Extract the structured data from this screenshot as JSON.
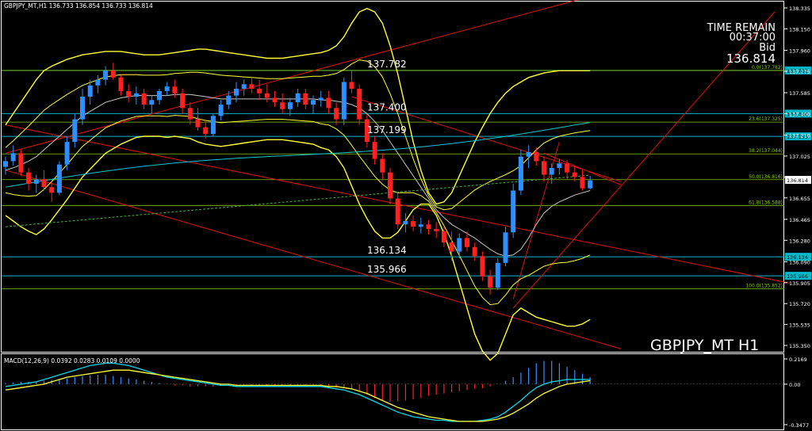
{
  "window": {
    "header": "GBPJPY_MT,H1  136.733 136.854 136.733 136.814",
    "symbol_label": "GBPJPY_MT H1"
  },
  "timer": {
    "title": "TIME REMAIN",
    "value": "00:37:00",
    "bid_label": "Bid",
    "bid_value": "136.814"
  },
  "chart_data": [
    {
      "type": "line",
      "title": "GBPJPY_MT,H1",
      "ylim": [
        135.35,
        138.335
      ],
      "y_ticks": [
        "138.335",
        "138.150",
        "137.960",
        "137.775",
        "137.585",
        "137.400",
        "137.210",
        "137.025",
        "136.840",
        "136.655",
        "136.465",
        "136.280",
        "136.090",
        "135.905",
        "135.720",
        "135.535",
        "135.350"
      ],
      "candles": [
        [
          136.93,
          137.02,
          136.86,
          136.98
        ],
        [
          136.98,
          137.12,
          136.94,
          137.05
        ],
        [
          137.05,
          137.08,
          136.85,
          136.88
        ],
        [
          136.88,
          136.92,
          136.72,
          136.78
        ],
        [
          136.78,
          136.86,
          136.7,
          136.82
        ],
        [
          136.82,
          136.9,
          136.72,
          136.75
        ],
        [
          136.75,
          136.8,
          136.62,
          136.7
        ],
        [
          136.7,
          136.98,
          136.68,
          136.95
        ],
        [
          136.95,
          137.2,
          136.9,
          137.15
        ],
        [
          137.15,
          137.4,
          137.1,
          137.35
        ],
        [
          137.35,
          137.62,
          137.3,
          137.55
        ],
        [
          137.55,
          137.7,
          137.48,
          137.65
        ],
        [
          137.65,
          137.74,
          137.58,
          137.7
        ],
        [
          137.7,
          137.82,
          137.65,
          137.78
        ],
        [
          137.78,
          137.85,
          137.7,
          137.72
        ],
        [
          137.72,
          137.74,
          137.56,
          137.6
        ],
        [
          137.6,
          137.66,
          137.5,
          137.55
        ],
        [
          137.55,
          137.64,
          137.48,
          137.58
        ],
        [
          137.58,
          137.62,
          137.44,
          137.48
        ],
        [
          137.48,
          137.56,
          137.4,
          137.52
        ],
        [
          137.52,
          137.62,
          137.48,
          137.6
        ],
        [
          137.6,
          137.68,
          137.56,
          137.64
        ],
        [
          137.64,
          137.7,
          137.54,
          137.58
        ],
        [
          137.58,
          137.62,
          137.4,
          137.45
        ],
        [
          137.45,
          137.5,
          137.3,
          137.35
        ],
        [
          137.35,
          137.45,
          137.25,
          137.28
        ],
        [
          137.28,
          137.34,
          137.18,
          137.22
        ],
        [
          137.22,
          137.4,
          137.2,
          137.38
        ],
        [
          137.38,
          137.52,
          137.34,
          137.48
        ],
        [
          137.48,
          137.6,
          137.44,
          137.56
        ],
        [
          137.56,
          137.68,
          137.5,
          137.62
        ],
        [
          137.62,
          137.7,
          137.56,
          137.66
        ],
        [
          137.66,
          137.72,
          137.58,
          137.62
        ],
        [
          137.62,
          137.7,
          137.52,
          137.58
        ],
        [
          137.58,
          137.66,
          137.5,
          137.54
        ],
        [
          137.54,
          137.6,
          137.46,
          137.5
        ],
        [
          137.5,
          137.58,
          137.4,
          137.44
        ],
        [
          137.44,
          137.54,
          137.38,
          137.5
        ],
        [
          137.5,
          137.62,
          137.46,
          137.58
        ],
        [
          137.58,
          137.62,
          137.44,
          137.48
        ],
        [
          137.48,
          137.56,
          137.4,
          137.52
        ],
        [
          137.52,
          137.6,
          137.46,
          137.54
        ],
        [
          137.54,
          137.6,
          137.4,
          137.45
        ],
        [
          137.45,
          137.5,
          137.3,
          137.35
        ],
        [
          137.35,
          137.72,
          137.3,
          137.68
        ],
        [
          137.68,
          137.78,
          137.58,
          137.62
        ],
        [
          137.62,
          137.66,
          137.3,
          137.35
        ],
        [
          137.35,
          137.4,
          137.1,
          137.15
        ],
        [
          137.15,
          137.2,
          136.95,
          137.0
        ],
        [
          137.0,
          137.05,
          136.82,
          136.88
        ],
        [
          136.88,
          136.92,
          136.6,
          136.65
        ],
        [
          136.65,
          136.7,
          136.38,
          136.42
        ],
        [
          136.42,
          136.52,
          136.35,
          136.45
        ],
        [
          136.45,
          136.5,
          136.36,
          136.4
        ],
        [
          136.4,
          136.48,
          136.34,
          136.42
        ],
        [
          136.42,
          136.46,
          136.33,
          136.38
        ],
        [
          136.38,
          136.44,
          136.3,
          136.36
        ],
        [
          136.36,
          136.4,
          136.22,
          136.26
        ],
        [
          136.26,
          136.36,
          136.1,
          136.18
        ],
        [
          136.18,
          136.34,
          136.12,
          136.3
        ],
        [
          136.3,
          136.36,
          136.18,
          136.22
        ],
        [
          136.22,
          136.26,
          136.1,
          136.14
        ],
        [
          136.14,
          136.18,
          135.92,
          135.96
        ],
        [
          135.96,
          136.02,
          135.8,
          135.86
        ],
        [
          135.86,
          136.12,
          135.84,
          136.08
        ],
        [
          136.08,
          136.4,
          136.05,
          136.35
        ],
        [
          136.35,
          136.78,
          136.3,
          136.72
        ],
        [
          136.72,
          137.08,
          136.68,
          137.02
        ],
        [
          137.02,
          137.12,
          136.92,
          137.06
        ],
        [
          137.06,
          137.1,
          136.94,
          136.98
        ],
        [
          136.98,
          137.02,
          136.8,
          136.86
        ],
        [
          136.86,
          136.96,
          136.78,
          136.92
        ],
        [
          136.92,
          137.0,
          136.86,
          136.96
        ],
        [
          136.96,
          136.99,
          136.82,
          136.88
        ],
        [
          136.88,
          136.94,
          136.8,
          136.84
        ],
        [
          136.84,
          136.9,
          136.72,
          136.74
        ],
        [
          136.74,
          136.85,
          136.73,
          136.81
        ]
      ],
      "bollinger_upper": [
        137.3,
        137.4,
        137.5,
        137.6,
        137.7,
        137.78,
        137.82,
        137.85,
        137.88,
        137.9,
        137.92,
        137.93,
        137.94,
        137.95,
        137.95,
        137.95,
        137.94,
        137.93,
        137.92,
        137.92,
        137.92,
        137.93,
        137.94,
        137.95,
        137.96,
        137.97,
        137.97,
        137.96,
        137.95,
        137.94,
        137.93,
        137.92,
        137.91,
        137.9,
        137.89,
        137.89,
        137.89,
        137.9,
        137.91,
        137.92,
        137.93,
        137.94,
        137.96,
        138.0,
        138.08,
        138.2,
        138.3,
        138.33,
        138.3,
        138.2,
        138.0,
        137.75,
        137.45,
        137.15,
        136.9,
        136.7,
        136.6,
        136.62,
        136.7,
        136.85,
        137.0,
        137.15,
        137.28,
        137.4,
        137.5,
        137.58,
        137.64,
        137.68,
        137.72,
        137.74,
        137.76,
        137.77,
        137.78,
        137.78,
        137.78,
        137.78,
        137.78
      ],
      "bollinger_mid": [
        136.9,
        136.92,
        136.95,
        136.98,
        137.02,
        137.08,
        137.14,
        137.2,
        137.26,
        137.32,
        137.38,
        137.42,
        137.46,
        137.5,
        137.52,
        137.54,
        137.55,
        137.56,
        137.56,
        137.56,
        137.56,
        137.56,
        137.57,
        137.57,
        137.57,
        137.56,
        137.55,
        137.54,
        137.53,
        137.53,
        137.53,
        137.53,
        137.53,
        137.53,
        137.53,
        137.53,
        137.53,
        137.53,
        137.53,
        137.53,
        137.53,
        137.52,
        137.52,
        137.51,
        137.5,
        137.48,
        137.45,
        137.4,
        137.33,
        137.25,
        137.15,
        137.05,
        136.95,
        136.85,
        136.75,
        136.65,
        136.55,
        136.48,
        136.42,
        136.38,
        136.34,
        136.3,
        136.25,
        136.2,
        136.16,
        136.14,
        136.15,
        136.2,
        136.3,
        136.42,
        136.52,
        136.58,
        136.62,
        136.65,
        136.68,
        136.7,
        136.72
      ],
      "bollinger_lower": [
        136.5,
        136.45,
        136.4,
        136.36,
        136.33,
        136.38,
        136.46,
        136.55,
        136.64,
        136.74,
        136.84,
        136.91,
        136.98,
        137.05,
        137.09,
        137.13,
        137.16,
        137.19,
        137.2,
        137.2,
        137.2,
        137.19,
        137.2,
        137.19,
        137.18,
        137.15,
        137.13,
        137.12,
        137.11,
        137.12,
        137.13,
        137.14,
        137.15,
        137.16,
        137.17,
        137.17,
        137.17,
        137.16,
        137.15,
        137.14,
        137.13,
        137.1,
        137.08,
        137.02,
        136.92,
        136.76,
        136.6,
        136.47,
        136.36,
        136.3,
        136.3,
        136.35,
        136.45,
        136.55,
        136.6,
        136.6,
        136.5,
        136.34,
        136.14,
        135.91,
        135.68,
        135.45,
        135.3,
        135.22,
        135.28,
        135.45,
        135.62,
        135.68,
        135.64,
        135.6,
        135.58,
        135.56,
        135.54,
        135.52,
        135.52,
        135.54,
        135.58
      ],
      "levels": [
        {
          "label": "137.782",
          "value": 137.782
        },
        {
          "label": "137.400",
          "value": 137.4
        },
        {
          "label": "137.199",
          "value": 137.199
        },
        {
          "label": "136.134",
          "value": 136.134
        },
        {
          "label": "135.966",
          "value": 135.966
        }
      ],
      "fibonacci": [
        {
          "label": "0.0(137.782)",
          "value": 137.782
        },
        {
          "label": "23.6(137.325)",
          "value": 137.325
        },
        {
          "label": "38.2(137.044)",
          "value": 137.044
        },
        {
          "label": "50.0(136.816)",
          "value": 136.816
        },
        {
          "label": "61.8(136.588)",
          "value": 136.588
        },
        {
          "label": "100.0(135.852)",
          "value": 135.852
        }
      ],
      "price_tags": [
        "137.782",
        "137.400",
        "137.199",
        "136.814",
        "136.134",
        "135.966"
      ],
      "colors": {
        "bull": "#2e8fff",
        "bear": "#ff2020",
        "band": "#ffff30",
        "level": "#00b8c8",
        "fib": "#86c800",
        "channel": "#e01010"
      }
    },
    {
      "type": "line",
      "title": "MACD(12,26,9) 0.0392 0.0283 0.0109 0.0000",
      "ylim": [
        -0.3477,
        0.2169
      ],
      "y_ticks": [
        "0.2169",
        "0.00",
        "-0.3477"
      ],
      "histogram": [
        0.01,
        0.015,
        0.02,
        0.02,
        0.025,
        0.03,
        0.035,
        0.04,
        0.05,
        0.06,
        0.07,
        0.075,
        0.08,
        0.08,
        0.07,
        0.06,
        0.05,
        0.04,
        0.03,
        0.02,
        0.01,
        0.0,
        -0.01,
        -0.01,
        -0.02,
        -0.02,
        -0.02,
        -0.02,
        -0.015,
        -0.01,
        -0.01,
        -0.01,
        -0.01,
        -0.01,
        -0.01,
        -0.01,
        -0.01,
        -0.01,
        -0.01,
        -0.01,
        -0.01,
        -0.01,
        -0.02,
        -0.03,
        -0.03,
        -0.04,
        -0.06,
        -0.09,
        -0.12,
        -0.14,
        -0.15,
        -0.15,
        -0.14,
        -0.13,
        -0.12,
        -0.1,
        -0.09,
        -0.08,
        -0.07,
        -0.06,
        -0.05,
        -0.04,
        -0.035,
        -0.02,
        0.0,
        0.03,
        0.06,
        0.1,
        0.14,
        0.18,
        0.2,
        0.2,
        0.18,
        0.15,
        0.12,
        0.09,
        0.06
      ],
      "series": [
        {
          "values": [
            -0.02,
            -0.01,
            0.0,
            0.01,
            0.02,
            0.04,
            0.06,
            0.08,
            0.1,
            0.12,
            0.14,
            0.16,
            0.17,
            0.18,
            0.18,
            0.17,
            0.16,
            0.14,
            0.12,
            0.1,
            0.08,
            0.06,
            0.05,
            0.04,
            0.03,
            0.02,
            0.01,
            0.0,
            -0.01,
            -0.01,
            -0.02,
            -0.02,
            -0.02,
            -0.02,
            -0.02,
            -0.02,
            -0.02,
            -0.02,
            -0.02,
            -0.02,
            -0.02,
            -0.02,
            -0.03,
            -0.04,
            -0.05,
            -0.07,
            -0.09,
            -0.12,
            -0.15,
            -0.18,
            -0.21,
            -0.24,
            -0.26,
            -0.28,
            -0.29,
            -0.3,
            -0.31,
            -0.31,
            -0.32,
            -0.32,
            -0.32,
            -0.32,
            -0.31,
            -0.3,
            -0.28,
            -0.24,
            -0.19,
            -0.14,
            -0.08,
            -0.03,
            0.0,
            0.02,
            0.03,
            0.04,
            0.04,
            0.04,
            0.04
          ]
        },
        {
          "values": [
            -0.05,
            -0.04,
            -0.03,
            -0.02,
            -0.01,
            0.0,
            0.02,
            0.04,
            0.06,
            0.07,
            0.08,
            0.09,
            0.1,
            0.11,
            0.12,
            0.12,
            0.12,
            0.11,
            0.1,
            0.09,
            0.08,
            0.07,
            0.06,
            0.05,
            0.04,
            0.03,
            0.02,
            0.01,
            0.0,
            0.0,
            -0.01,
            -0.01,
            -0.01,
            -0.01,
            -0.01,
            -0.01,
            -0.01,
            -0.01,
            -0.01,
            -0.01,
            -0.01,
            -0.01,
            -0.02,
            -0.02,
            -0.03,
            -0.04,
            -0.06,
            -0.08,
            -0.11,
            -0.14,
            -0.17,
            -0.2,
            -0.22,
            -0.24,
            -0.26,
            -0.28,
            -0.29,
            -0.3,
            -0.31,
            -0.32,
            -0.32,
            -0.32,
            -0.32,
            -0.31,
            -0.3,
            -0.28,
            -0.25,
            -0.21,
            -0.17,
            -0.12,
            -0.08,
            -0.05,
            -0.02,
            0.0,
            0.01,
            0.02,
            0.03
          ]
        }
      ],
      "colors": {
        "hist_pos": "#2e8fff",
        "hist_neg": "#ff2020",
        "main": "#00d8e8",
        "signal": "#ffff30"
      }
    }
  ]
}
